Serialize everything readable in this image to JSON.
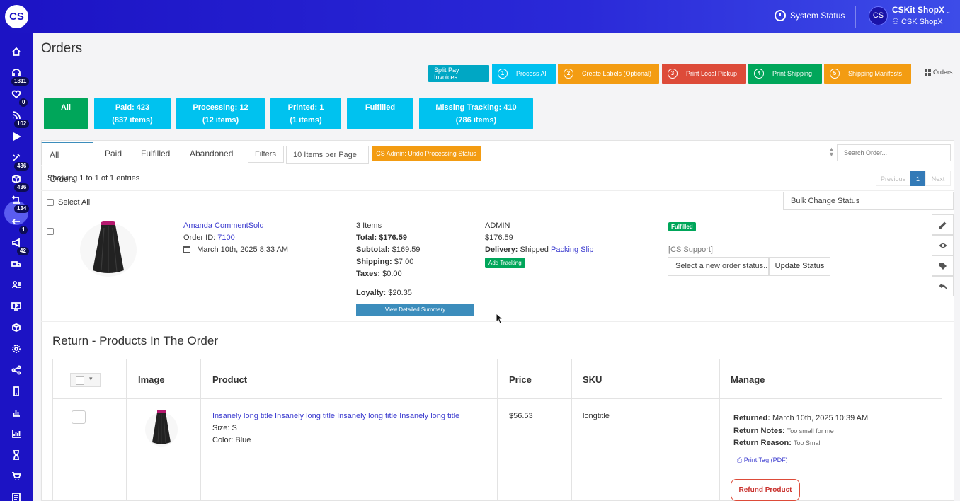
{
  "app": {
    "logo_text": "CS"
  },
  "topbar": {
    "system_status": "System Status",
    "avatar_initials": "CS",
    "account_name": "CSKit ShopX",
    "account_sub": "CSK ShopX"
  },
  "sidebar": {
    "badges": {
      "b1811": "1811",
      "b0": "0",
      "b102": "102",
      "b436a": "436",
      "b436b": "436",
      "b134": "134",
      "b1": "1",
      "b42": "42"
    }
  },
  "page": {
    "title": "Orders"
  },
  "toolbar": {
    "split_pay": "Split Pay Invoices",
    "process_all": {
      "num": "1",
      "label": "Process All"
    },
    "create_labels": {
      "num": "2",
      "label": "Create Labels (Optional)"
    },
    "print_local": {
      "num": "3",
      "label": "Print Local Pickup"
    },
    "print_shipping": {
      "num": "4",
      "label": "Print Shipping"
    },
    "shipping_manifests": {
      "num": "5",
      "label": "Shipping Manifests"
    },
    "orders_link": "Orders",
    "colors": {
      "teal": "#00a7c4",
      "cyan": "#00c0ef",
      "orange": "#f39c12",
      "red": "#dd4b39",
      "green": "#00a65a"
    }
  },
  "filters": {
    "all": {
      "line1": "All"
    },
    "paid": {
      "line1": "Paid: 423",
      "line2": "(837 items)"
    },
    "processing": {
      "line1": "Processing: 12",
      "line2": "(12 items)"
    },
    "printed": {
      "line1": "Printed: 1",
      "line2": "(1 items)"
    },
    "fulfilled": {
      "line1": "Fulfilled"
    },
    "missing": {
      "line1": "Missing Tracking: 410",
      "line2": "(786 items)"
    }
  },
  "tabs": [
    "All Orders",
    "Paid",
    "Fulfilled",
    "Abandoned"
  ],
  "controls": {
    "filters": "Filters",
    "per_page": "10 Items per Page",
    "undo": "CS Admin: Undo Processing Status",
    "search_placeholder": "Search Order..."
  },
  "list": {
    "showing": "Showing 1 to 1 of 1 entries",
    "pager": {
      "prev": "Previous",
      "current": "1",
      "next": "Next"
    },
    "select_all": "Select All",
    "bulk_change": "Bulk Change Status"
  },
  "order": {
    "customer": "Amanda CommentSold",
    "order_id_label": "Order ID:",
    "order_id": "7100",
    "date": "March 10th, 2025 8:33 AM",
    "items": "3 Items",
    "total_label": "Total:",
    "total": "$176.59",
    "subtotal_label": "Subtotal:",
    "subtotal": "$169.59",
    "shipping_label": "Shipping:",
    "shipping": "$7.00",
    "taxes_label": "Taxes:",
    "taxes": "$0.00",
    "loyalty_label": "Loyalty:",
    "loyalty": "$20.35",
    "summary_btn": "View Detailed Summary",
    "admin": "ADMIN",
    "admin_amount": "$176.59",
    "delivery_label": "Delivery:",
    "delivery": "Shipped",
    "packing_slip": "Packing Slip",
    "add_tracking": "Add Tracking",
    "status_badge": "Fulfilled",
    "support": "[CS Support]",
    "status_select": "Select a new order status..",
    "update_status": "Update Status"
  },
  "returns": {
    "title": "Return - Products In The Order",
    "headers": {
      "image": "Image",
      "product": "Product",
      "price": "Price",
      "sku": "SKU",
      "manage": "Manage"
    },
    "row": {
      "product_title": "Insanely long title Insanely long title Insanely long title Insanely long title",
      "size": "Size: S",
      "color": "Color: Blue",
      "price": "$56.53",
      "sku": "longtitle",
      "returned_label": "Returned:",
      "returned": "March 10th, 2025 10:39 AM",
      "notes_label": "Return Notes:",
      "notes": "Too small for me",
      "reason_label": "Return Reason:",
      "reason": "Too Small",
      "print_tag": "Print Tag (PDF)",
      "refund": "Refund Product"
    }
  }
}
